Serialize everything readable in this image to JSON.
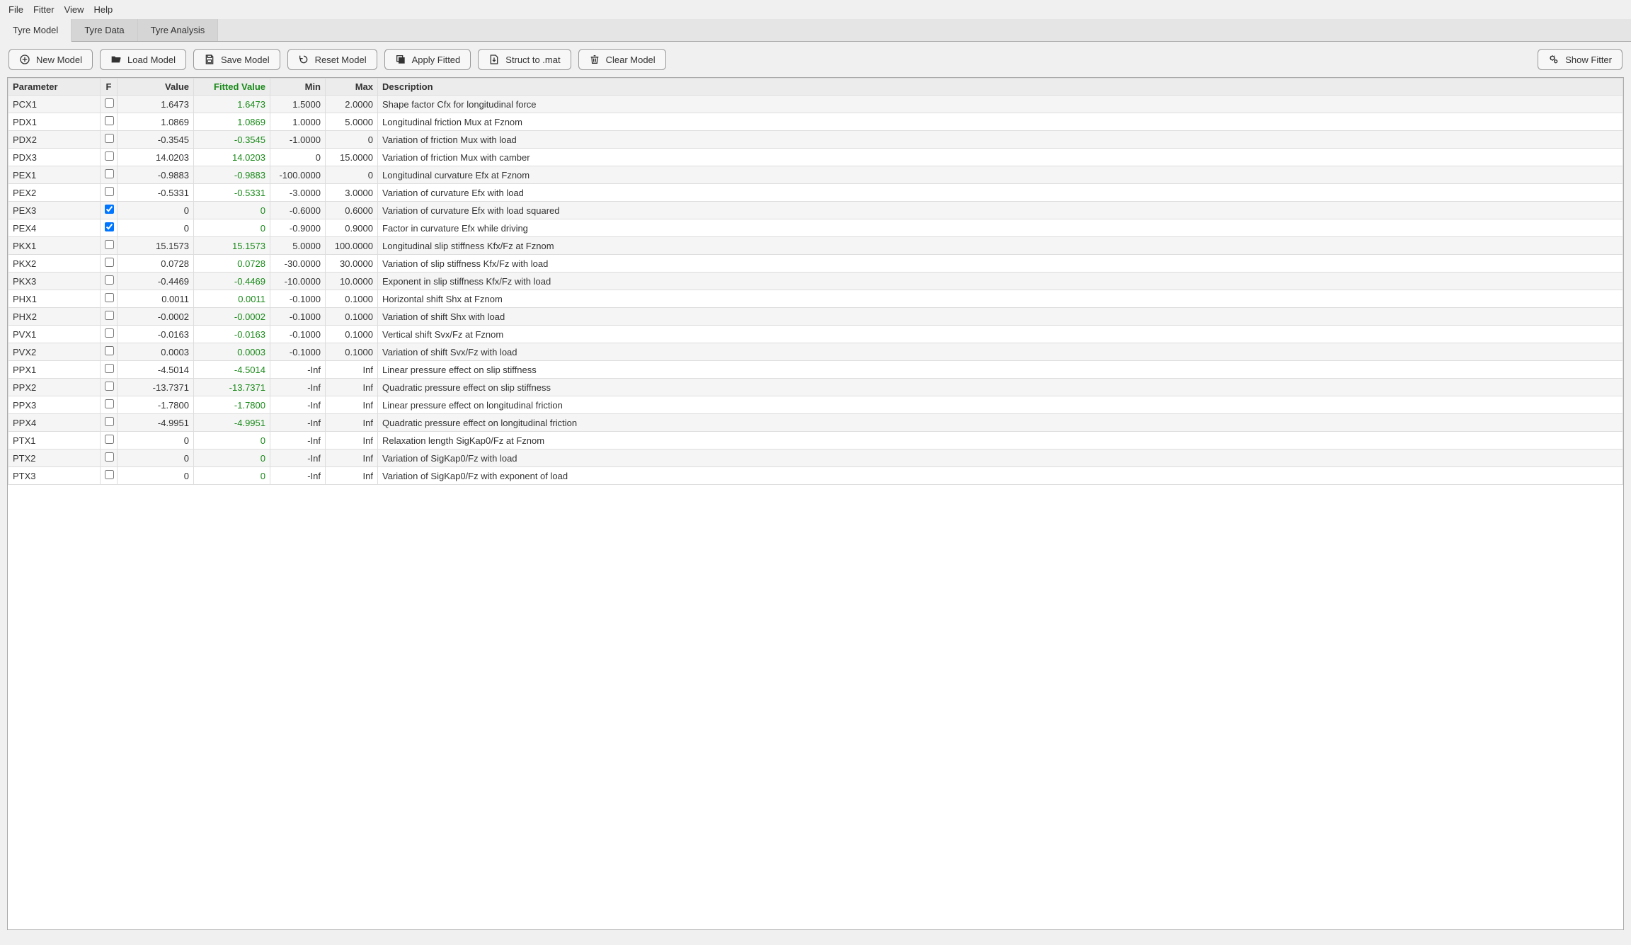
{
  "menu": {
    "file": "File",
    "fitter": "Fitter",
    "view": "View",
    "help": "Help"
  },
  "tabs": {
    "model": "Tyre Model",
    "data": "Tyre Data",
    "analysis": "Tyre Analysis"
  },
  "toolbar": {
    "new": "New Model",
    "load": "Load Model",
    "save": "Save Model",
    "reset": "Reset Model",
    "apply": "Apply Fitted",
    "struct": "Struct to .mat",
    "clear": "Clear Model",
    "showfitter": "Show Fitter"
  },
  "cols": {
    "param": "Parameter",
    "f": "F",
    "value": "Value",
    "fitted": "Fitted Value",
    "min": "Min",
    "max": "Max",
    "desc": "Description"
  },
  "rows": [
    {
      "p": "PCX1",
      "f": false,
      "v": "1.6473",
      "fit": "1.6473",
      "min": "1.5000",
      "max": "2.0000",
      "d": "Shape factor Cfx for longitudinal force"
    },
    {
      "p": "PDX1",
      "f": false,
      "v": "1.0869",
      "fit": "1.0869",
      "min": "1.0000",
      "max": "5.0000",
      "d": "Longitudinal friction Mux at Fznom"
    },
    {
      "p": "PDX2",
      "f": false,
      "v": "-0.3545",
      "fit": "-0.3545",
      "min": "-1.0000",
      "max": "0",
      "d": "Variation of friction Mux with load"
    },
    {
      "p": "PDX3",
      "f": false,
      "v": "14.0203",
      "fit": "14.0203",
      "min": "0",
      "max": "15.0000",
      "d": "Variation of friction Mux with camber"
    },
    {
      "p": "PEX1",
      "f": false,
      "v": "-0.9883",
      "fit": "-0.9883",
      "min": "-100.0000",
      "max": "0",
      "d": "Longitudinal curvature Efx at Fznom"
    },
    {
      "p": "PEX2",
      "f": false,
      "v": "-0.5331",
      "fit": "-0.5331",
      "min": "-3.0000",
      "max": "3.0000",
      "d": "Variation of curvature Efx with load"
    },
    {
      "p": "PEX3",
      "f": true,
      "v": "0",
      "fit": "0",
      "min": "-0.6000",
      "max": "0.6000",
      "d": "Variation of curvature Efx with load squared"
    },
    {
      "p": "PEX4",
      "f": true,
      "v": "0",
      "fit": "0",
      "min": "-0.9000",
      "max": "0.9000",
      "d": "Factor in curvature Efx while driving"
    },
    {
      "p": "PKX1",
      "f": false,
      "v": "15.1573",
      "fit": "15.1573",
      "min": "5.0000",
      "max": "100.0000",
      "d": "Longitudinal slip stiffness Kfx/Fz at Fznom"
    },
    {
      "p": "PKX2",
      "f": false,
      "v": "0.0728",
      "fit": "0.0728",
      "min": "-30.0000",
      "max": "30.0000",
      "d": "Variation of slip stiffness Kfx/Fz with load"
    },
    {
      "p": "PKX3",
      "f": false,
      "v": "-0.4469",
      "fit": "-0.4469",
      "min": "-10.0000",
      "max": "10.0000",
      "d": "Exponent in slip stiffness Kfx/Fz with load"
    },
    {
      "p": "PHX1",
      "f": false,
      "v": "0.0011",
      "fit": "0.0011",
      "min": "-0.1000",
      "max": "0.1000",
      "d": "Horizontal shift Shx at Fznom"
    },
    {
      "p": "PHX2",
      "f": false,
      "v": "-0.0002",
      "fit": "-0.0002",
      "min": "-0.1000",
      "max": "0.1000",
      "d": "Variation of shift Shx with load"
    },
    {
      "p": "PVX1",
      "f": false,
      "v": "-0.0163",
      "fit": "-0.0163",
      "min": "-0.1000",
      "max": "0.1000",
      "d": "Vertical shift Svx/Fz at Fznom"
    },
    {
      "p": "PVX2",
      "f": false,
      "v": "0.0003",
      "fit": "0.0003",
      "min": "-0.1000",
      "max": "0.1000",
      "d": "Variation of shift Svx/Fz with load"
    },
    {
      "p": "PPX1",
      "f": false,
      "v": "-4.5014",
      "fit": "-4.5014",
      "min": "-Inf",
      "max": "Inf",
      "d": "Linear pressure effect on slip stiffness"
    },
    {
      "p": "PPX2",
      "f": false,
      "v": "-13.7371",
      "fit": "-13.7371",
      "min": "-Inf",
      "max": "Inf",
      "d": "Quadratic pressure effect on slip stiffness"
    },
    {
      "p": "PPX3",
      "f": false,
      "v": "-1.7800",
      "fit": "-1.7800",
      "min": "-Inf",
      "max": "Inf",
      "d": "Linear pressure effect on longitudinal friction"
    },
    {
      "p": "PPX4",
      "f": false,
      "v": "-4.9951",
      "fit": "-4.9951",
      "min": "-Inf",
      "max": "Inf",
      "d": "Quadratic pressure effect on longitudinal friction"
    },
    {
      "p": "PTX1",
      "f": false,
      "v": "0",
      "fit": "0",
      "min": "-Inf",
      "max": "Inf",
      "d": "Relaxation length SigKap0/Fz at Fznom"
    },
    {
      "p": "PTX2",
      "f": false,
      "v": "0",
      "fit": "0",
      "min": "-Inf",
      "max": "Inf",
      "d": "Variation of SigKap0/Fz with load"
    },
    {
      "p": "PTX3",
      "f": false,
      "v": "0",
      "fit": "0",
      "min": "-Inf",
      "max": "Inf",
      "d": "Variation of SigKap0/Fz with exponent of load"
    }
  ]
}
